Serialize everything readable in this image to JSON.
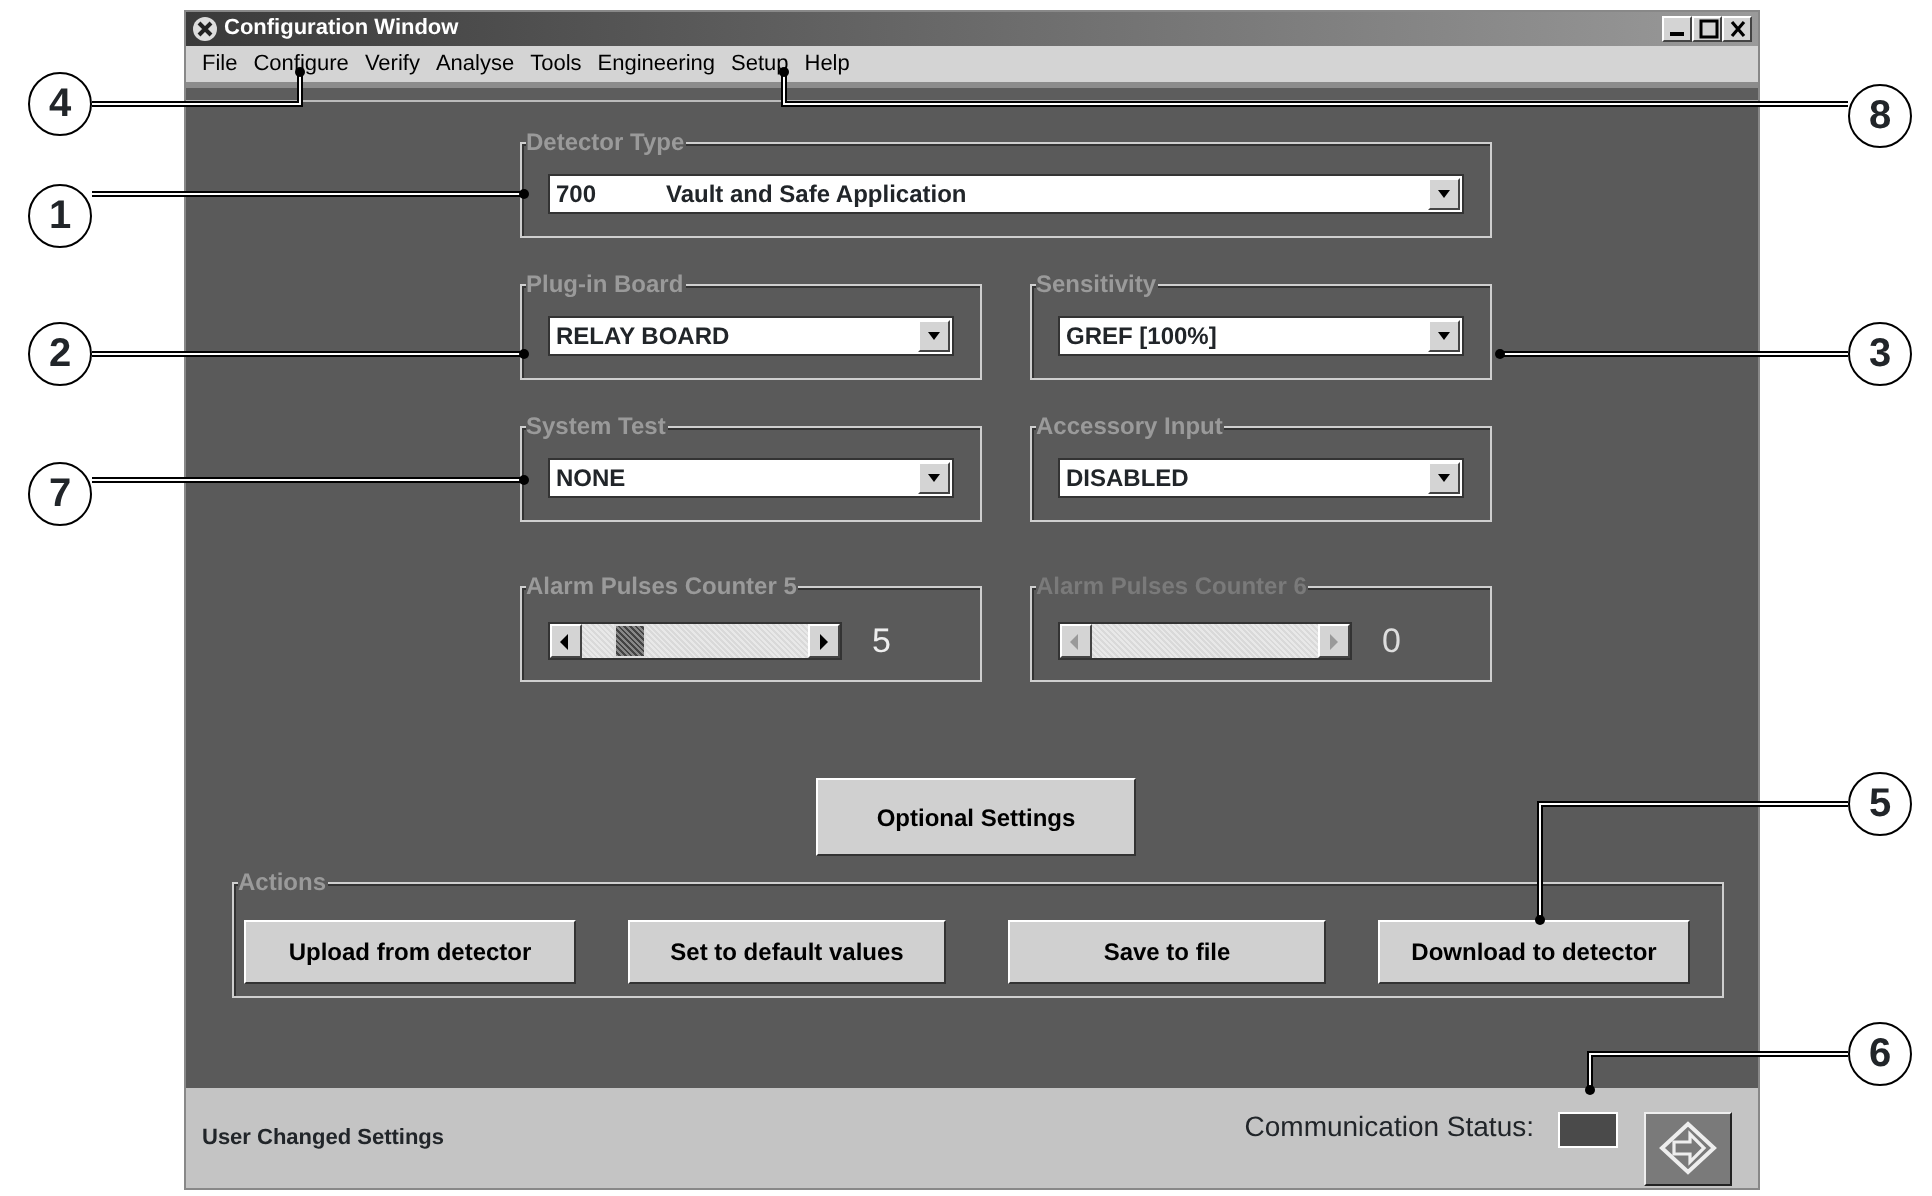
{
  "window": {
    "title": "Configuration Window"
  },
  "menu": [
    "File",
    "Configure",
    "Verify",
    "Analyse",
    "Tools",
    "Engineering",
    "Setup",
    "Help"
  ],
  "detector_type": {
    "label": "Detector Type",
    "code": "700",
    "value": "Vault and Safe Application"
  },
  "dropdown_groups": [
    {
      "label": "Plug-in Board",
      "value": "RELAY BOARD"
    },
    {
      "label": "Sensitivity",
      "value": "GREF [100%]"
    },
    {
      "label": "System Test",
      "value": "NONE"
    },
    {
      "label": "Accessory Input",
      "value": "DISABLED"
    }
  ],
  "counters": [
    {
      "label": "Alarm Pulses Counter 5",
      "reading": "5",
      "disabled": false
    },
    {
      "label": "Alarm Pulses Counter 6",
      "reading": "0",
      "disabled": true
    }
  ],
  "optional_button": "Optional Settings",
  "actions": {
    "label": "Actions",
    "buttons": [
      "Upload from detector",
      "Set to default values",
      "Save to file",
      "Download to detector"
    ]
  },
  "status_bar": {
    "message": "User Changed Settings",
    "communication_label": "Communication Status:"
  },
  "callouts": [
    {
      "number": "4"
    },
    {
      "number": "8"
    },
    {
      "number": "1"
    },
    {
      "number": "2"
    },
    {
      "number": "3"
    },
    {
      "number": "7"
    },
    {
      "number": "5"
    },
    {
      "number": "6"
    }
  ]
}
